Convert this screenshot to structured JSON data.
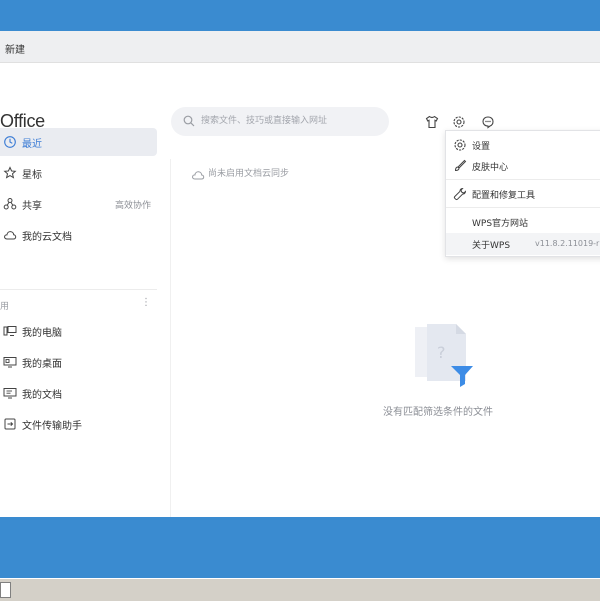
{
  "window": {
    "tab_new": "新建",
    "logo": "Office"
  },
  "search": {
    "placeholder": "搜索文件、技巧或直接输入网址"
  },
  "sidebar": {
    "items": [
      {
        "label": "最近",
        "icon": "clock-icon"
      },
      {
        "label": "星标",
        "icon": "star-icon"
      },
      {
        "label": "共享",
        "icon": "share-icon",
        "extra": "高效协作"
      },
      {
        "label": "我的云文档",
        "icon": "cloud-icon"
      }
    ],
    "section_label": "用",
    "section_more": "⋮",
    "locations": [
      {
        "label": "我的电脑",
        "icon": "computer-icon"
      },
      {
        "label": "我的桌面",
        "icon": "desktop-icon"
      },
      {
        "label": "我的文档",
        "icon": "documents-icon"
      },
      {
        "label": "文件传输助手",
        "icon": "file-transfer-icon"
      }
    ]
  },
  "main": {
    "sync_status": "尚未启用文档云同步",
    "empty_text": "没有匹配筛选条件的文件"
  },
  "settings_menu": {
    "items": [
      {
        "label": "设置",
        "icon": "gear-icon"
      },
      {
        "label": "皮肤中心",
        "icon": "brush-icon"
      },
      {
        "label": "配置和修复工具",
        "icon": "wrench-icon"
      },
      {
        "label": "WPS官方网站"
      },
      {
        "label": "关于WPS",
        "version": "v11.8.2.11019-r"
      }
    ]
  },
  "colors": {
    "desktop": "#3a8bd0",
    "accent": "#3a7bd5",
    "empty_illustration": "#3d8ce6"
  }
}
